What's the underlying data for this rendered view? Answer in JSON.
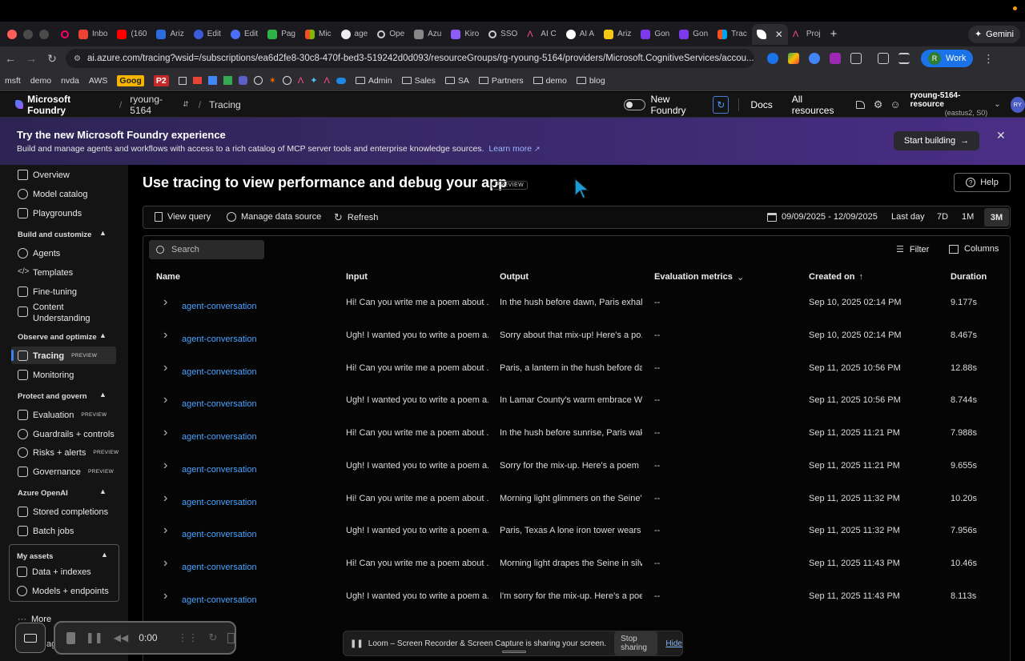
{
  "browser": {
    "tabs": [
      "Inbo",
      "(160",
      "Ariz",
      "Edit",
      "Edit",
      "Pag",
      "Mic",
      "age",
      "Ope",
      "Azu",
      "Kiro",
      "SSO",
      "AI C",
      "AI A",
      "Ariz",
      "Gon",
      "Gon",
      "Trac",
      "",
      "Proj"
    ],
    "new_tab": "+",
    "gemini_label": "Gemini",
    "url": "ai.azure.com/tracing?wsid=/subscriptions/ea6d2fe8-30c8-470f-bed3-519242d0d093/resourceGroups/rg-ryoung-5164/providers/Microsoft.CognitiveServices/accou...",
    "profile_label": "Work",
    "profile_initial": "R",
    "bookmarks": [
      "msft",
      "demo",
      "nvda",
      "AWS",
      "Goog",
      "P2",
      "Admin",
      "Sales",
      "SA",
      "Partners",
      "demo",
      "blog"
    ]
  },
  "app_header": {
    "brand": "Microsoft Foundry",
    "breadcrumb_project": "ryoung-5164",
    "breadcrumb_page": "Tracing",
    "toggle_label": "New Foundry",
    "docs": "Docs",
    "all_resources": "All resources",
    "resource_name": "ryoung-5164-resource",
    "resource_region": "(eastus2, S0)",
    "avatar_initials": "RY"
  },
  "banner": {
    "title": "Try the new Microsoft Foundry experience",
    "body": "Build and manage agents and workflows with access to a rich catalog of MCP server tools and enterprise knowledge sources.",
    "link": "Learn more",
    "cta": "Start building"
  },
  "sidebar": {
    "top_items": [
      "Overview",
      "Model catalog",
      "Playgrounds"
    ],
    "sections": [
      {
        "title": "Build and customize",
        "items": [
          "Agents",
          "Templates",
          "Fine-tuning",
          "Content",
          "Understanding"
        ]
      },
      {
        "title": "Observe and optimize",
        "items": [
          "Tracing",
          "Monitoring"
        ]
      },
      {
        "title": "Protect and govern",
        "items": [
          "Evaluation",
          "Guardrails + controls",
          "Risks + alerts",
          "Governance"
        ]
      },
      {
        "title": "Azure OpenAI",
        "items": [
          "Stored completions",
          "Batch jobs"
        ]
      },
      {
        "title": "My assets",
        "items": [
          "Data + indexes",
          "Models + endpoints"
        ]
      }
    ],
    "more": "More",
    "preview_badge": "PREVIEW"
  },
  "page": {
    "title": "Use tracing to view performance and debug your app",
    "title_badge": "PREVIEW",
    "help": "Help",
    "toolbar": {
      "view_query": "View query",
      "manage_data_source": "Manage data source",
      "refresh": "Refresh",
      "date_range": "09/09/2025 - 12/09/2025",
      "ranges": [
        "Last day",
        "7D",
        "1M",
        "3M"
      ]
    },
    "search_placeholder": "Search",
    "filter": "Filter",
    "columns": "Columns"
  },
  "table": {
    "headers": [
      "Name",
      "Input",
      "Output",
      "Evaluation metrics",
      "Created on",
      "Duration"
    ],
    "rows": [
      {
        "name": "agent-conversation",
        "input": "Hi! Can you write me a poem about ...",
        "output": "In the hush before dawn, Paris exhale...",
        "eval": "--",
        "created": "Sep 10, 2025 02:14 PM",
        "duration": "9.177s"
      },
      {
        "name": "agent-conversation",
        "input": "Ugh! I wanted you to write a poem a...",
        "output": "Sorry about that mix-up! Here's a po...",
        "eval": "--",
        "created": "Sep 10, 2025 02:14 PM",
        "duration": "8.467s"
      },
      {
        "name": "agent-conversation",
        "input": "Hi! Can you write me a poem about ...",
        "output": "Paris, a lantern in the hush before da...",
        "eval": "--",
        "created": "Sep 11, 2025 10:56 PM",
        "duration": "12.88s"
      },
      {
        "name": "agent-conversation",
        "input": "Ugh! I wanted you to write a poem a...",
        "output": "In Lamar County's warm embrace Wh...",
        "eval": "--",
        "created": "Sep 11, 2025 10:56 PM",
        "duration": "8.744s"
      },
      {
        "name": "agent-conversation",
        "input": "Hi! Can you write me a poem about ...",
        "output": "In the hush before sunrise, Paris wak...",
        "eval": "--",
        "created": "Sep 11, 2025 11:21 PM",
        "duration": "7.988s"
      },
      {
        "name": "agent-conversation",
        "input": "Ugh! I wanted you to write a poem a...",
        "output": "Sorry for the mix-up. Here's a poem ...",
        "eval": "--",
        "created": "Sep 11, 2025 11:21 PM",
        "duration": "9.655s"
      },
      {
        "name": "agent-conversation",
        "input": "Hi! Can you write me a poem about ...",
        "output": "Morning light glimmers on the Seine'...",
        "eval": "--",
        "created": "Sep 11, 2025 11:32 PM",
        "duration": "10.20s"
      },
      {
        "name": "agent-conversation",
        "input": "Ugh! I wanted you to write a poem a...",
        "output": "Paris, Texas A lone iron tower wears i...",
        "eval": "--",
        "created": "Sep 11, 2025 11:32 PM",
        "duration": "7.956s"
      },
      {
        "name": "agent-conversation",
        "input": "Hi! Can you write me a poem about ...",
        "output": "Morning light drapes the Seine in silv...",
        "eval": "--",
        "created": "Sep 11, 2025 11:43 PM",
        "duration": "10.46s"
      },
      {
        "name": "agent-conversation",
        "input": "Ugh! I wanted you to write a poem a...",
        "output": "I'm sorry for the mix-up. Here's a poe...",
        "eval": "--",
        "created": "Sep 11, 2025 11:43 PM",
        "duration": "8.113s"
      }
    ]
  },
  "loom": {
    "timer": "0:00",
    "share_text": "Loom – Screen Recorder & Screen Capture is sharing your screen.",
    "stop": "Stop sharing",
    "hide": "Hide",
    "partial_label": "ag"
  }
}
